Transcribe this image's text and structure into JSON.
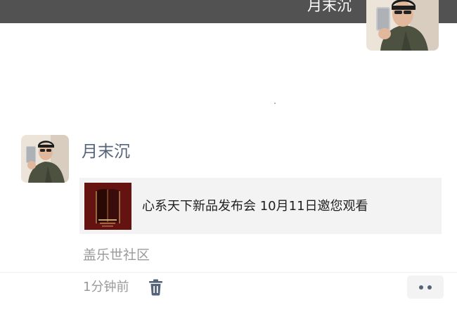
{
  "header": {
    "name": "月末沉"
  },
  "post": {
    "user_name": "月末沉",
    "share_card": {
      "title": "心系天下新品发布会 10月11日邀您观看"
    },
    "source": "盖乐世社区",
    "timestamp": "1分钟前"
  },
  "icons": {
    "delete": "trash-icon",
    "more": "more-dots-icon"
  },
  "colors": {
    "header_bg": "#525252",
    "name_link": "#55637a",
    "meta_text": "#9a9a9a",
    "card_bg": "#f3f3f3"
  }
}
